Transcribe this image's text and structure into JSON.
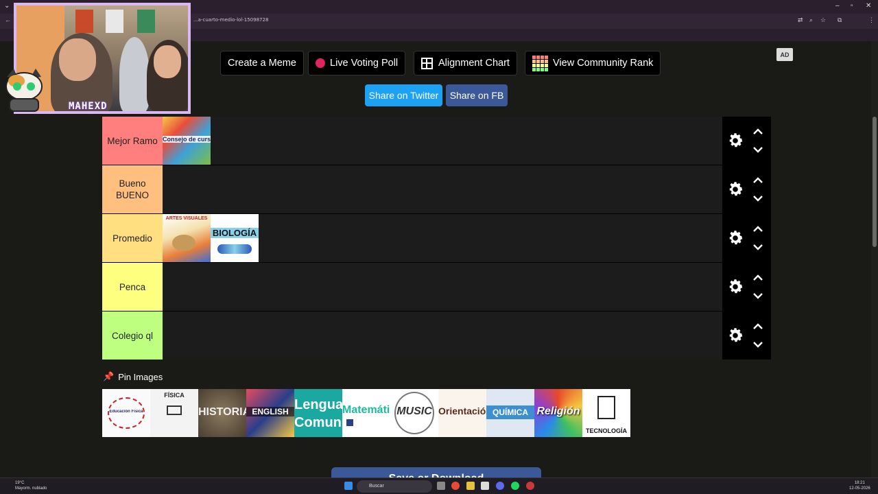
{
  "browser": {
    "url": "...a-cuarto-medio-lol-15098728",
    "window_controls": [
      "–",
      "▫",
      "✕"
    ]
  },
  "toolbar": {
    "create_meme": "Create a Meme",
    "live_voting": "Live Voting Poll",
    "alignment_chart": "Alignment Chart",
    "community_rank": "View Community Rank",
    "ad": "AD"
  },
  "share": {
    "twitter": "Share on Twitter",
    "facebook": "Share on FB"
  },
  "tiers": [
    {
      "label": "Mejor Ramo",
      "color": "#ff7f7f",
      "items": [
        "Consejo de curso"
      ]
    },
    {
      "label": "Bueno BUENO",
      "color": "#ffbf7f",
      "items": []
    },
    {
      "label": "Promedio",
      "color": "#ffdf7f",
      "items": [
        "ARTES VISUALES",
        "BIOLOGÍA"
      ]
    },
    {
      "label": "Penca",
      "color": "#ffff7f",
      "items": []
    },
    {
      "label": "Colegio ql",
      "color": "#bfff7f",
      "items": []
    }
  ],
  "pin_images": {
    "title": "Pin Images",
    "items": [
      "Educación Física",
      "FÍSICA",
      "HISTORIA",
      "ENGLISH",
      "Lenguaje Comunicación",
      "Matemática",
      "MUSIC",
      "Orientación",
      "QUÍMICA",
      "Religión",
      "TECNOLOGÍA"
    ]
  },
  "save_button": "Save or Download",
  "stream": {
    "name_tag": "MAHEXD"
  },
  "taskbar": {
    "weather_temp": "19°C",
    "weather_desc": "Mayorm. nublado",
    "search": "Buscar",
    "time": "18:21",
    "date": "12-05-2026"
  }
}
